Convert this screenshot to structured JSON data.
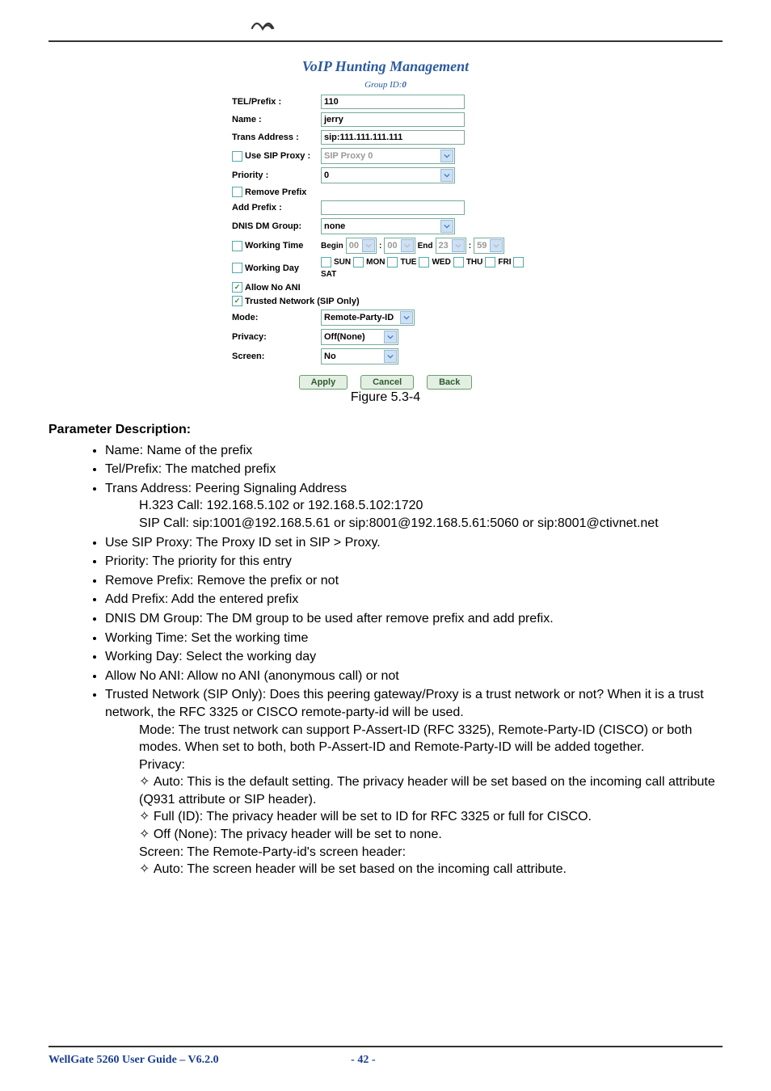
{
  "panel": {
    "title": "VoIP Hunting Management",
    "group_label": "Group ID:",
    "group_value": "0",
    "rows": {
      "tel_prefix": {
        "label": "TEL/Prefix :",
        "value": "110"
      },
      "name": {
        "label": "Name :",
        "value": "jerry"
      },
      "trans_address": {
        "label": "Trans Address :",
        "value": "sip:111.111.111.111"
      },
      "use_sip_proxy": {
        "label": "Use SIP Proxy :",
        "value": "SIP Proxy 0"
      },
      "priority": {
        "label": "Priority :",
        "value": "0"
      },
      "remove_prefix": {
        "label": "Remove Prefix"
      },
      "add_prefix": {
        "label": "Add Prefix :",
        "value": ""
      },
      "dnis_dm": {
        "label": "DNIS DM Group:",
        "value": "none"
      },
      "working_time": {
        "label": "Working Time",
        "begin": "Begin",
        "bh": "00",
        "bm": "00",
        "end": "End",
        "eh": "23",
        "em": "59"
      },
      "working_day": {
        "label": "Working Day",
        "days": [
          "SUN",
          "MON",
          "TUE",
          "WED",
          "THU",
          "FRI",
          "SAT"
        ]
      },
      "allow_no_ani": {
        "label": "Allow No ANI"
      },
      "trusted": {
        "label": "Trusted Network (SIP Only)"
      },
      "mode": {
        "label": "Mode:",
        "value": "Remote-Party-ID"
      },
      "privacy": {
        "label": "Privacy:",
        "value": "Off(None)"
      },
      "screen": {
        "label": "Screen:",
        "value": "No"
      }
    },
    "buttons": {
      "apply": "Apply",
      "cancel": "Cancel",
      "back": "Back"
    },
    "figure": "Figure 5.3-4"
  },
  "body": {
    "param_heading": "Parameter Description:",
    "b1": "Name: Name of the prefix",
    "b2": "Tel/Prefix: The matched prefix",
    "b3": "Trans Address: Peering Signaling Address",
    "b3a": "H.323 Call: 192.168.5.102 or 192.168.5.102:1720",
    "b3b": "SIP Call: sip:1001@192.168.5.61 or sip:8001@192.168.5.61:5060 or sip:8001@ctivnet.net",
    "b4": "Use SIP Proxy: The Proxy ID set in SIP > Proxy.",
    "b5": "Priority: The priority for this entry",
    "b6": "Remove Prefix: Remove the prefix or not",
    "b7": "Add Prefix: Add the entered prefix",
    "b8": "DNIS DM Group: The DM group to be used after remove prefix and add prefix.",
    "b9": "Working Time: Set the working time",
    "b10": "Working Day: Select the working day",
    "b11": "Allow No ANI: Allow no ANI (anonymous call) or not",
    "b12": "Trusted Network (SIP Only): Does this peering gateway/Proxy is a trust network or not? When it is a trust network, the RFC 3325 or CISCO remote-party-id will be used.",
    "b12a": "Mode: The trust network can support P-Assert-ID (RFC 3325), Remote-Party-ID (CISCO) or both modes. When set to both, both P-Assert-ID and Remote-Party-ID will be added together.",
    "b12b": "Privacy:",
    "d1": "Auto: This is the default setting. The privacy header will be set based on the incoming call attribute (Q931 attribute or SIP header).",
    "d2": "Full (ID): The privacy header will be set to ID for RFC 3325 or full for CISCO.",
    "d3": "Off (None): The privacy header will be set to none.",
    "b12c": "Screen: The Remote-Party-id's screen header:",
    "d4": "Auto: The screen header will be set based on the incoming call attribute."
  },
  "footer": {
    "left": "WellGate 5260 User Guide – V6.2.0",
    "page": "- 42 -"
  }
}
